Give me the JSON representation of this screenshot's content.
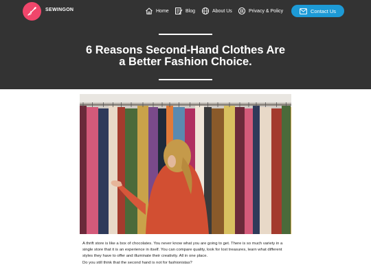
{
  "brand": {
    "name": "SEWINGON",
    "logo_icon": "needle-thread-icon",
    "logo_color": "#f0466b"
  },
  "nav": {
    "items": [
      {
        "label": "Home",
        "icon": "home-icon"
      },
      {
        "label": "Blog",
        "icon": "blog-icon"
      },
      {
        "label": "About Us",
        "icon": "globe-icon"
      },
      {
        "label": "Privacy & Policy",
        "icon": "shield-icon"
      }
    ],
    "contact": {
      "label": "Contact Us",
      "icon": "mail-icon",
      "color": "#1d9ad6"
    }
  },
  "page": {
    "title": "6 Reasons Second-Hand Clothes Are\na  Better Fashion Choice.",
    "header_bg": "#333333"
  },
  "hero": {
    "icon": "thrift-store-photo"
  },
  "article": {
    "paragraphs": [
      "A thrift store is like a box of chocolates. You never know what you are going to get. There is so much variety in a single store that it is an experience in itself. You can compare quality, look for lost treasures, learn what different styles they have to offer and illuminate their creativity. All in one place.",
      "Do you still think that the second hand is not for fashionistas?"
    ]
  }
}
